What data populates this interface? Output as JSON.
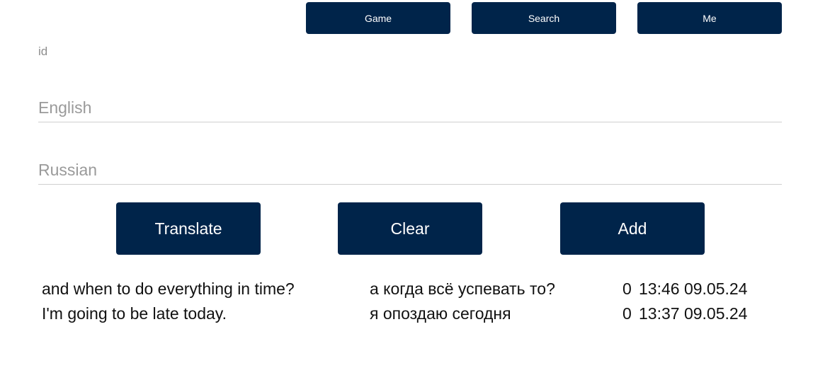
{
  "nav": {
    "game": "Game",
    "search": "Search",
    "me": "Me"
  },
  "form": {
    "id_label": "id",
    "english_placeholder": "English",
    "english_value": "",
    "russian_placeholder": "Russian",
    "russian_value": ""
  },
  "actions": {
    "translate": "Translate",
    "clear": "Clear",
    "add": "Add"
  },
  "entries": [
    {
      "english": "and when to do everything in time?",
      "russian": "а когда всё успевать то?",
      "count": "0",
      "timestamp": "13:46 09.05.24"
    },
    {
      "english": "I'm going to be late today.",
      "russian": "я опоздаю сегодня",
      "count": "0",
      "timestamp": "13:37 09.05.24"
    }
  ],
  "colors": {
    "button_bg": "#00244a",
    "button_text": "#ffffff",
    "placeholder": "#9a9a9a",
    "divider": "#cfcfcf"
  }
}
